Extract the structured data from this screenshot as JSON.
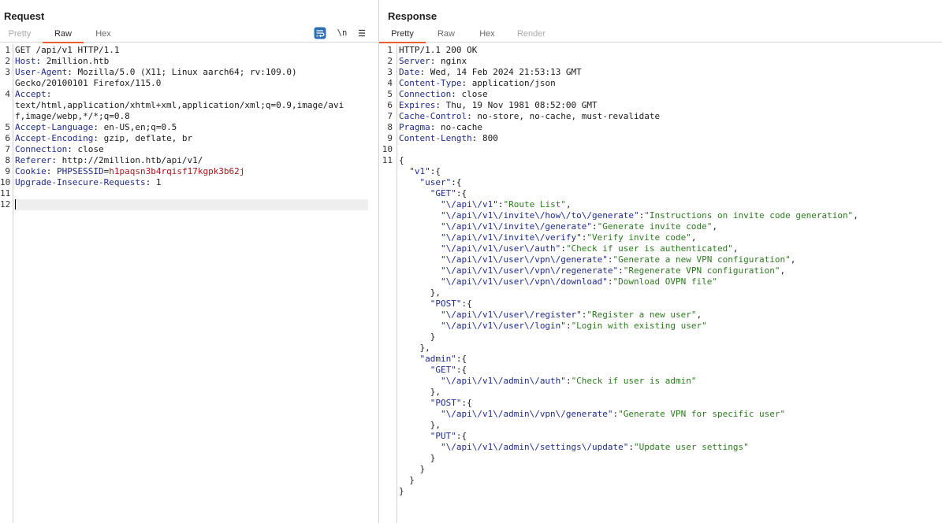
{
  "request": {
    "title": "Request",
    "tabs": [
      {
        "label": "Pretty",
        "state": "inactive"
      },
      {
        "label": "Raw",
        "state": "active"
      },
      {
        "label": "Hex",
        "state": "inactive"
      }
    ],
    "toolbar": {
      "wrap_icon": "wrap-lines-icon",
      "newline_label": "\\n",
      "menu_icon": "hamburger-menu-icon"
    },
    "line_numbers": [
      "1",
      "2",
      "3",
      "",
      "4",
      "",
      "",
      "5",
      "6",
      "7",
      "8",
      "9",
      "10",
      "11",
      "12"
    ],
    "lines": {
      "l1": "GET /api/v1 HTTP/1.1",
      "l2_key": "Host",
      "l2_val": "2million.htb",
      "l3_key": "User-Agent",
      "l3_val": "Mozilla/5.0 (X11; Linux aarch64; rv:109.0)",
      "l3_wrap": "Gecko/20100101 Firefox/115.0",
      "l4_key": "Accept",
      "l4_wrap1": "text/html,application/xhtml+xml,application/xml;q=0.9,image/avi",
      "l4_wrap2": "f,image/webp,*/*;q=0.8",
      "l5_key": "Accept-Language",
      "l5_val": "en-US,en;q=0.5",
      "l6_key": "Accept-Encoding",
      "l6_val": "gzip, deflate, br",
      "l7_key": "Connection",
      "l7_val": "close",
      "l8_key": "Referer",
      "l8_val": "http://2million.htb/api/v1/",
      "l9_key": "Cookie",
      "l9_ck": "PHPSESSID",
      "l9_cv": "h1paqsn3b4rqisf17kgpk3b62j",
      "l10_key": "Upgrade-Insecure-Requests",
      "l10_val": "1"
    }
  },
  "response": {
    "title": "Response",
    "tabs": [
      {
        "label": "Pretty",
        "state": "active"
      },
      {
        "label": "Raw",
        "state": "inactive"
      },
      {
        "label": "Hex",
        "state": "inactive"
      },
      {
        "label": "Render",
        "state": "disabled"
      }
    ],
    "line_numbers": [
      "1",
      "2",
      "3",
      "4",
      "5",
      "6",
      "7",
      "8",
      "9",
      "10",
      "11"
    ],
    "headers": {
      "status": "HTTP/1.1 200 OK",
      "h2k": "Server",
      "h2v": "nginx",
      "h3k": "Date",
      "h3v": "Wed, 14 Feb 2024 21:53:13 GMT",
      "h4k": "Content-Type",
      "h4v": "application/json",
      "h5k": "Connection",
      "h5v": "close",
      "h6k": "Expires",
      "h6v": "Thu, 19 Nov 1981 08:52:00 GMT",
      "h7k": "Cache-Control",
      "h7v": "no-store, no-cache, must-revalidate",
      "h8k": "Pragma",
      "h8v": "no-cache",
      "h9k": "Content-Length",
      "h9v": "800"
    },
    "json": {
      "open_brace": "{",
      "v1_key": "\"v1\"",
      "user_key": "\"user\"",
      "get_key": "\"GET\"",
      "post_key": "\"POST\"",
      "put_key": "\"PUT\"",
      "admin_key": "\"admin\"",
      "user_get": [
        {
          "k": "\"\\/api\\/v1\"",
          "v": "\"Route List\"",
          "sep": ","
        },
        {
          "k": "\"\\/api\\/v1\\/invite\\/how\\/to\\/generate\"",
          "v": "\"Instructions on invite code generation\"",
          "sep": ","
        },
        {
          "k": "\"\\/api\\/v1\\/invite\\/generate\"",
          "v": "\"Generate invite code\"",
          "sep": ","
        },
        {
          "k": "\"\\/api\\/v1\\/invite\\/verify\"",
          "v": "\"Verify invite code\"",
          "sep": ","
        },
        {
          "k": "\"\\/api\\/v1\\/user\\/auth\"",
          "v": "\"Check if user is authenticated\"",
          "sep": ","
        },
        {
          "k": "\"\\/api\\/v1\\/user\\/vpn\\/generate\"",
          "v": "\"Generate a new VPN configuration\"",
          "sep": ","
        },
        {
          "k": "\"\\/api\\/v1\\/user\\/vpn\\/regenerate\"",
          "v": "\"Regenerate VPN configuration\"",
          "sep": ","
        },
        {
          "k": "\"\\/api\\/v1\\/user\\/vpn\\/download\"",
          "v": "\"Download OVPN file\"",
          "sep": ""
        }
      ],
      "user_post": [
        {
          "k": "\"\\/api\\/v1\\/user\\/register\"",
          "v": "\"Register a new user\"",
          "sep": ","
        },
        {
          "k": "\"\\/api\\/v1\\/user\\/login\"",
          "v": "\"Login with existing user\"",
          "sep": ""
        }
      ],
      "admin_get": {
        "k": "\"\\/api\\/v1\\/admin\\/auth\"",
        "v": "\"Check if user is admin\""
      },
      "admin_post": {
        "k": "\"\\/api\\/v1\\/admin\\/vpn\\/generate\"",
        "v": "\"Generate VPN for specific user\""
      },
      "admin_put": {
        "k": "\"\\/api\\/v1\\/admin\\/settings\\/update\"",
        "v": "\"Update user settings\""
      }
    }
  }
}
